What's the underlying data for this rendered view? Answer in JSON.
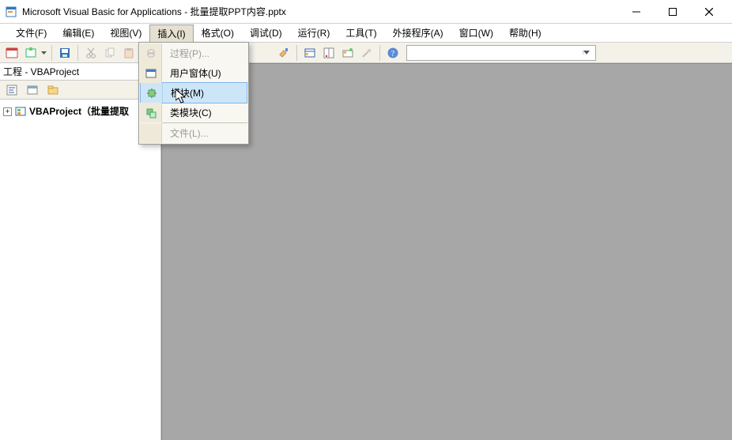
{
  "title": "Microsoft Visual Basic for Applications - 批量提取PPT内容.pptx",
  "menu": {
    "file": "文件(F)",
    "edit": "编辑(E)",
    "view": "视图(V)",
    "insert": "插入(I)",
    "format": "格式(O)",
    "debug": "调试(D)",
    "run": "运行(R)",
    "tools": "工具(T)",
    "addins": "外接程序(A)",
    "window": "窗口(W)",
    "help": "帮助(H)"
  },
  "insert_menu": {
    "procedure": "过程(P)...",
    "userform": "用户窗体(U)",
    "module": "模块(M)",
    "class_module": "类模块(C)",
    "file": "文件(L)..."
  },
  "project_pane": {
    "title": "工程 - VBAProject",
    "tree_root": "VBAProject（批量提取"
  }
}
